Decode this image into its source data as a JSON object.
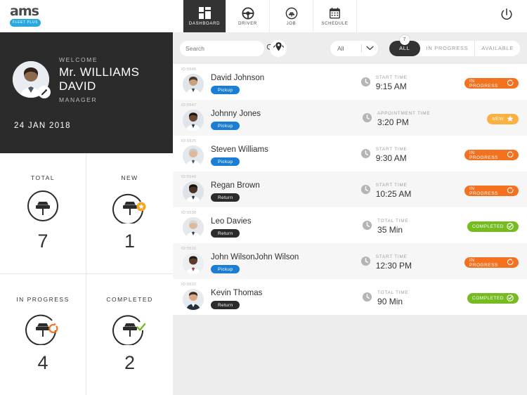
{
  "brand": {
    "logo": "ams",
    "badge": "FLEET PLUS"
  },
  "nav": {
    "items": [
      {
        "label": "DASHBOARD",
        "icon": "grid-icon",
        "active": true
      },
      {
        "label": "DRIVER",
        "icon": "steering-wheel-icon",
        "active": false
      },
      {
        "label": "JOB",
        "icon": "car-circle-icon",
        "active": false
      },
      {
        "label": "SCHEDULE",
        "icon": "calendar-icon",
        "active": false
      }
    ],
    "power_icon": "power-icon"
  },
  "welcome": {
    "greeting": "WELCOME",
    "name": "Mr. WILLIAMS DAVID",
    "role": "MANAGER",
    "date": "24 JAN 2018",
    "edit_icon": "pencil-icon"
  },
  "stats": [
    {
      "label": "TOTAL",
      "value": "7",
      "icon": "car-total-icon",
      "accent": "#2b2b2b"
    },
    {
      "label": "NEW",
      "value": "1",
      "icon": "car-new-star-icon",
      "accent": "#f5a623"
    },
    {
      "label": "IN PROGRESS",
      "value": "4",
      "icon": "car-progress-icon",
      "accent": "#f4711f"
    },
    {
      "label": "COMPLETED",
      "value": "2",
      "icon": "car-completed-icon",
      "accent": "#76bc21"
    }
  ],
  "filters": {
    "search_placeholder": "Search",
    "search_value": "",
    "search_icon": "search-icon",
    "map_pin_icon": "map-pin-icon",
    "select_value": "All",
    "select_options": [
      "All"
    ],
    "chevron_icon": "chevron-down-icon",
    "segments": [
      {
        "label": "ALL",
        "active": true,
        "badge": "7"
      },
      {
        "label": "IN PROGRESS",
        "active": false,
        "badge": ""
      },
      {
        "label": "AVAILABLE",
        "active": false,
        "badge": ""
      }
    ]
  },
  "jobs": [
    {
      "id": "ID:5545",
      "name": "David Johnson",
      "tag": "Pickup",
      "tag_type": "pickup",
      "time_label": "START TIME",
      "time_value": "9:15 AM",
      "status": "IN PROGRESS",
      "status_type": "in-progress",
      "status_icon": "spinner-icon",
      "color": "#f4711f"
    },
    {
      "id": "ID:5547",
      "name": "Johnny Jones",
      "tag": "Pickup",
      "tag_type": "pickup",
      "time_label": "APPOINTMENT TIME",
      "time_value": "3:20 PM",
      "status": "NEW",
      "status_type": "new",
      "status_icon": "star-icon",
      "color": "#fbb040"
    },
    {
      "id": "ID:5525",
      "name": "Steven Williams",
      "tag": "Pickup",
      "tag_type": "pickup",
      "time_label": "START TIME",
      "time_value": "9:30 AM",
      "status": "IN PROGRESS",
      "status_type": "in-progress",
      "status_icon": "spinner-icon",
      "color": "#f4711f"
    },
    {
      "id": "ID:5540",
      "name": "Regan Brown",
      "tag": "Return",
      "tag_type": "return",
      "time_label": "START TIME",
      "time_value": "10:25 AM",
      "status": "IN PROGRESS",
      "status_type": "in-progress",
      "status_icon": "spinner-icon",
      "color": "#f4711f"
    },
    {
      "id": "ID:5538",
      "name": "Leo Davies",
      "tag": "Return",
      "tag_type": "return",
      "time_label": "TOTAL TIME",
      "time_value": "35 Min",
      "status": "COMPLETED",
      "status_type": "completed",
      "status_icon": "check-circle-icon",
      "color": "#76bc21"
    },
    {
      "id": "ID:5515",
      "name": "John WilsonJohn Wilson",
      "tag": "Pickup",
      "tag_type": "pickup",
      "time_label": "START TIME",
      "time_value": "12:30 PM",
      "status": "IN PROGRESS",
      "status_type": "in-progress",
      "status_icon": "spinner-icon",
      "color": "#f4711f"
    },
    {
      "id": "ID:5522",
      "name": "Kevin Thomas",
      "tag": "Return",
      "tag_type": "return",
      "time_label": "TOTAL TIME",
      "time_value": "90 Min",
      "status": "COMPLETED",
      "status_type": "completed",
      "status_icon": "check-circle-icon",
      "color": "#76bc21"
    }
  ],
  "clock_icon": "clock-icon"
}
